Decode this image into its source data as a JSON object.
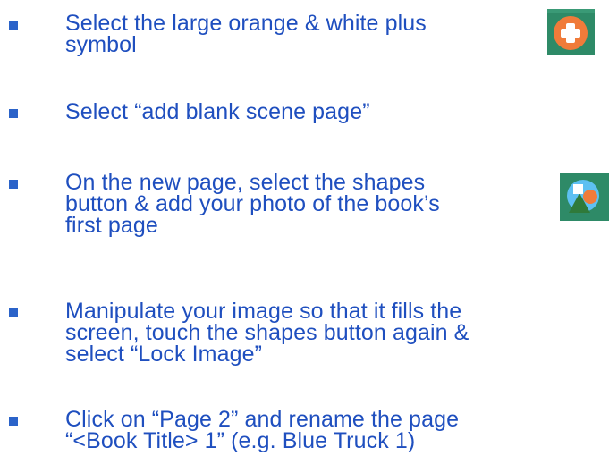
{
  "instructions": [
    {
      "lines": [
        "Select the large orange & white plus",
        "symbol"
      ],
      "icon": "orange-plus-icon"
    },
    {
      "lines": [
        "Select “add blank scene page”"
      ]
    },
    {
      "lines": [
        "On the new page, select the shapes",
        "button & add your photo of the book’s",
        "first page"
      ],
      "icon": "shapes-icon"
    },
    {
      "lines": [
        "Manipulate your image so that it fills the",
        "screen, touch the shapes button again &",
        "select “Lock Image”"
      ]
    },
    {
      "lines": [
        "Click on “Page 2” and rename the page",
        "“<Book Title> 1” (e.g. Blue Truck 1)"
      ]
    }
  ],
  "colors": {
    "text": "#1f4fbf",
    "bullet": "#2b63c9",
    "icon_background": "#2e8a67",
    "plus_orange": "#f07b3a"
  }
}
